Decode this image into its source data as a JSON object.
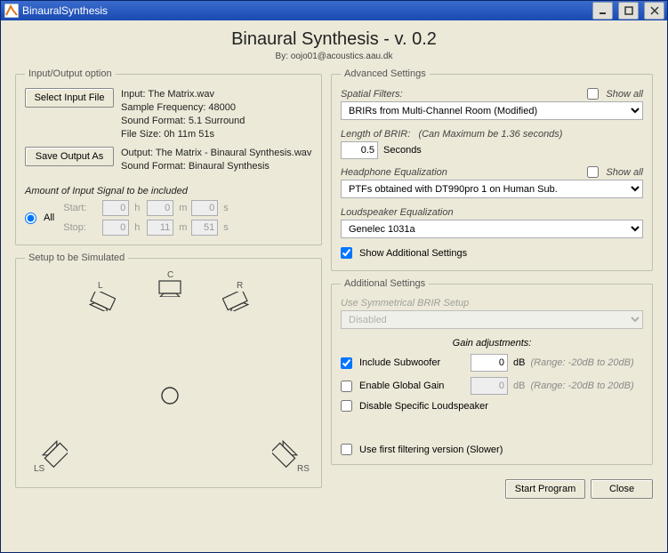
{
  "window": {
    "title": "BinauralSynthesis"
  },
  "header": {
    "title": "Binaural Synthesis - v. 0.2",
    "byline": "By: oojo01@acoustics.aau.dk"
  },
  "io": {
    "legend": "Input/Output option",
    "select_btn": "Select Input File",
    "save_btn": "Save Output As",
    "input_line1": "Input: The Matrix.wav",
    "input_line2": "Sample Frequency: 48000",
    "input_line3": "Sound Format: 5.1 Surround",
    "input_line4": "File Size: 0h 11m 51s",
    "output_line1": "Output: The Matrix - Binaural Synthesis.wav",
    "output_line2": "Sound Format: Binaural Synthesis",
    "amount_label": "Amount of Input Signal to be included",
    "all_label": "All",
    "start_label": "Start:",
    "stop_label": "Stop:",
    "start_h": "0",
    "start_m": "0",
    "start_s": "0",
    "stop_h": "0",
    "stop_m": "11",
    "stop_s": "51",
    "h": "h",
    "m": "m",
    "s": "s"
  },
  "sim": {
    "legend": "Setup to be Simulated",
    "L": "L",
    "C": "C",
    "R": "R",
    "LS": "LS",
    "RS": "RS"
  },
  "adv": {
    "legend": "Advanced Settings",
    "spatial_label": "Spatial Filters:",
    "show_all": "Show all",
    "spatial_value": "BRIRs from Multi-Channel Room (Modified)",
    "brir_len_label": "Length of BRIR:",
    "brir_len_hint": "(Can Maximum be 1.36 seconds)",
    "brir_len_value": "0.5",
    "seconds": "Seconds",
    "hp_label": "Headphone Equalization",
    "hp_value": "PTFs obtained with DT990pro 1 on Human Sub.",
    "ls_label": "Loudspeaker Equalization",
    "ls_value": "Genelec 1031a",
    "show_more": "Show Additional Settings"
  },
  "add": {
    "legend": "Additional Settings",
    "sym_label": "Use Symmetrical BRIR Setup",
    "sym_value": "Disabled",
    "gain_header": "Gain adjustments:",
    "sub_label": "Include Subwoofer",
    "sub_gain": "0",
    "db": "dB",
    "range": "(Range: -20dB to 20dB)",
    "glob_label": "Enable Global Gain",
    "glob_gain": "0",
    "disable_spk": "Disable Specific Loudspeaker",
    "use_first": "Use first filtering version (Slower)"
  },
  "footer": {
    "start": "Start Program",
    "close": "Close"
  }
}
